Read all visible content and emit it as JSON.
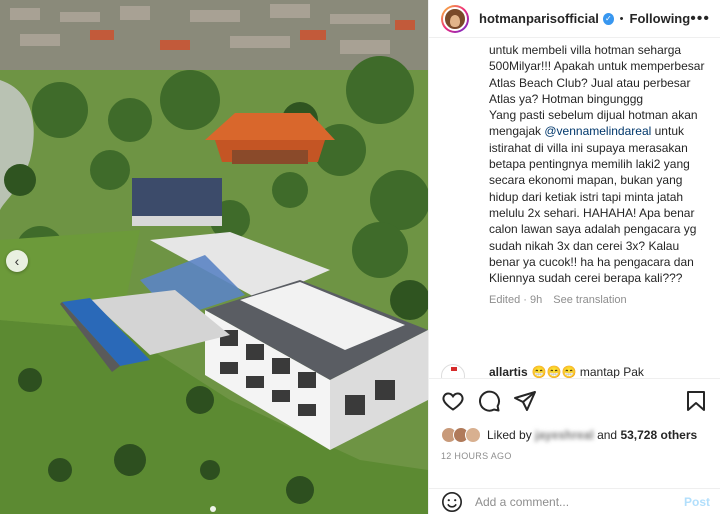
{
  "post": {
    "username": "hotmanparisofficial",
    "separator": "•",
    "follow_status": "Following",
    "more_label": "•••",
    "verified_glyph": "✓"
  },
  "caption": {
    "line_1": "untuk membeli villa hotman seharga 500Milyar!!! Apakah untuk memperbesar Atlas Beach Club? Jual atau perbesar Atlas ya? Hotman bingunggg",
    "line_2_before": "Yang pasti sebelum dijual hotman akan mengajak ",
    "mention": "@vennamelindareal",
    "line_2_after": " untuk istirahat di villa ini supaya merasakan betapa pentingnya memilih laki2 yang secara ekonomi mapan, bukan yang hidup dari ketiak istri tapi minta jatah melulu 2x sehari. HAHAHA! Apa benar calon lawan saya adalah pengacara yg sudah nikah 3x dan cerei 3x? Kalau benar ya cucok!! ha ha pengacara dan Kliennya sudah cerei berapa kali???",
    "edited": "Edited · 9h",
    "see_translation": "See translation"
  },
  "comment": {
    "user": "allartis",
    "text": "😁😁😁 mantap Pak"
  },
  "likes": {
    "prefix": "Liked by ",
    "blurred_user": "jayeshreal",
    "middle": " and ",
    "count": "53,728 others",
    "time": "12 HOURS AGO"
  },
  "add_comment": {
    "placeholder": "Add a comment...",
    "post_label": "Post"
  },
  "photo": {
    "prev_glyph": "‹"
  },
  "icons": [
    "heart-icon",
    "comment-icon",
    "share-icon",
    "bookmark-icon",
    "emoji-icon",
    "verified-icon",
    "chevron-left-icon"
  ],
  "colors": {
    "link": "#00376b",
    "muted": "#8e8e8e",
    "verified": "#3897f0",
    "post_disabled": "#b2dffc"
  }
}
